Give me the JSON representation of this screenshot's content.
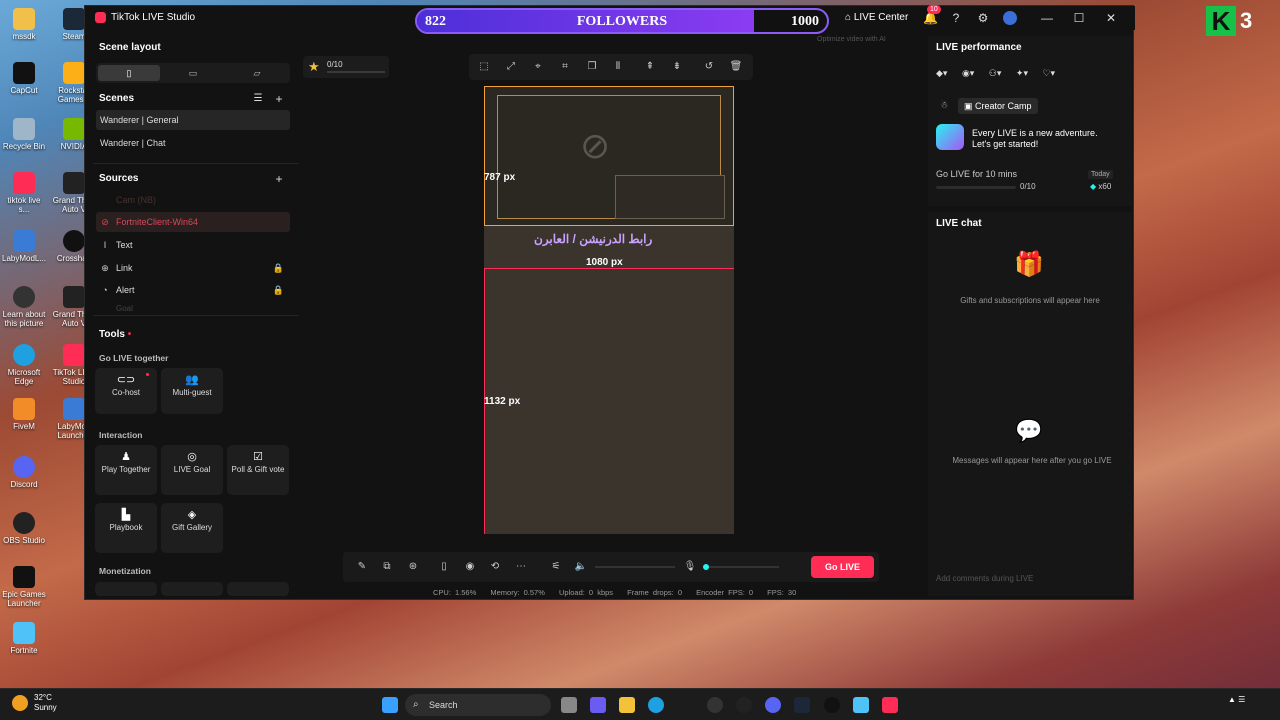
{
  "desktop": {
    "icons": [
      {
        "label": "mssdk"
      },
      {
        "label": "Steam"
      },
      {
        "label": "CapCut"
      },
      {
        "label": "Rockstar Games..."
      },
      {
        "label": "Recycle Bin"
      },
      {
        "label": "NVIDIA"
      },
      {
        "label": "tiktok live s..."
      },
      {
        "label": "Grand Theft Auto V"
      },
      {
        "label": "LabyModL..."
      },
      {
        "label": "Crosshair"
      },
      {
        "label": "Learn about this picture"
      },
      {
        "label": "Grand Theft Auto V"
      },
      {
        "label": "Microsoft Edge"
      },
      {
        "label": "TikTok LIVE Studio"
      },
      {
        "label": "FiveM"
      },
      {
        "label": "LabyMod Launcher"
      },
      {
        "label": "Discord"
      },
      {
        "label": "OBS Studio"
      },
      {
        "label": "Epic Games Launcher"
      },
      {
        "label": "Fortnite"
      }
    ],
    "overlay_number": "3"
  },
  "window": {
    "title": "TikTok LIVE Studio",
    "live_center": "LIVE Center",
    "notifications": "10"
  },
  "followers_goal": {
    "current": "822",
    "label": "FOLLOWERS",
    "target": "1000",
    "progress": 0.822
  },
  "left": {
    "scene_layout_title": "Scene layout",
    "scenes_title": "Scenes",
    "scenes": [
      {
        "label": "Wanderer | General"
      },
      {
        "label": "Wanderer | Chat"
      }
    ],
    "sources_title": "Sources",
    "sources": [
      {
        "label": "Cam (NB)",
        "state": "dim"
      },
      {
        "label": "FortniteClient-Win64",
        "state": "error"
      },
      {
        "label": "Text",
        "icon": "I"
      },
      {
        "label": "Link",
        "icon": "⊕"
      },
      {
        "label": "Alert",
        "icon": "🔔"
      },
      {
        "label": "Goal",
        "state": "dim"
      }
    ],
    "tools_title": "Tools",
    "go_live_together": "Go LIVE together",
    "co_host": "Co-host",
    "multi_guest": "Multi-guest",
    "interaction": "Interaction",
    "play_together": "Play Together",
    "live_goal": "LIVE Goal",
    "poll_gift": "Poll & Gift vote",
    "playbook": "Playbook",
    "gift_gallery": "Gift Gallery",
    "monetization": "Monetization"
  },
  "canvas": {
    "star_count": "0/10",
    "optimize": "Optimize video with AI",
    "label_787": "787 px",
    "label_1080": "1080 px",
    "label_1132": "1132 px",
    "arabic_text": "رابط الدرنيشن / العابرن"
  },
  "bottom": {
    "go_live": "Go LIVE",
    "cpu": "CPU: 1.56%",
    "memory": "Memory: 0.57%",
    "upload": "Upload: 0 kbps",
    "frame_drops": "Frame drops: 0",
    "encoder_fps": "Encoder FPS: 0",
    "fps": "FPS: 30"
  },
  "right": {
    "performance_title": "LIVE performance",
    "creator_camp": "Creator Camp",
    "adventure_line1": "Every LIVE is a new adventure.",
    "adventure_line2": "Let's get started!",
    "go_live_task": "Go LIVE for 10 mins",
    "today": "Today",
    "task_progress": "0/10",
    "reward": "x60",
    "chat_title": "LIVE chat",
    "gifts_msg": "Gifts and subscriptions will appear here",
    "messages_msg": "Messages will appear here after you go LIVE",
    "comment_placeholder": "Add comments during LIVE"
  },
  "taskbar": {
    "temperature": "32°C",
    "weather": "Sunny",
    "search": "Search"
  }
}
